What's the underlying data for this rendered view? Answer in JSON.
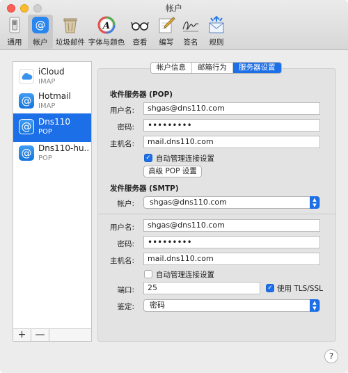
{
  "window": {
    "title": "帐户"
  },
  "toolbar": {
    "items": [
      {
        "label": "通用",
        "icon": "light-switch-icon"
      },
      {
        "label": "帐户",
        "icon": "at-sign-icon",
        "selected": true
      },
      {
        "label": "垃圾邮件",
        "icon": "trash-bin-icon"
      },
      {
        "label": "字体与颜色",
        "icon": "font-palette-icon"
      },
      {
        "label": "查看",
        "icon": "eyeglasses-icon"
      },
      {
        "label": "编写",
        "icon": "pencil-paper-icon"
      },
      {
        "label": "签名",
        "icon": "signature-icon"
      },
      {
        "label": "规则",
        "icon": "envelope-arrows-icon"
      }
    ]
  },
  "accounts": [
    {
      "name": "iCloud",
      "type": "IMAP",
      "icon": "cloud-icon"
    },
    {
      "name": "Hotmail",
      "type": "IMAP",
      "icon": "at-sign-icon"
    },
    {
      "name": "Dns110",
      "type": "POP",
      "icon": "at-sign-icon",
      "selected": true
    },
    {
      "name": "Dns110-hu...",
      "type": "POP",
      "icon": "at-sign-icon"
    }
  ],
  "list_buttons": {
    "add": "+",
    "remove": "—"
  },
  "tabs": [
    {
      "label": "帐户信息"
    },
    {
      "label": "邮箱行为"
    },
    {
      "label": "服务器设置",
      "selected": true
    }
  ],
  "incoming": {
    "heading": "收件服务器 (POP)",
    "username_label": "用户名:",
    "username": "shgas@dns110.com",
    "password_label": "密码:",
    "password": "•••••••••",
    "host_label": "主机名:",
    "host": "mail.dns110.com",
    "auto_manage_label": "自动管理连接设置",
    "auto_manage": true,
    "advanced_button": "高级 POP 设置"
  },
  "outgoing": {
    "heading": "发件服务器 (SMTP)",
    "account_label": "帐户:",
    "account": "shgas@dns110.com",
    "username_label": "用户名:",
    "username": "shgas@dns110.com",
    "password_label": "密码:",
    "password": "•••••••••",
    "host_label": "主机名:",
    "host": "mail.dns110.com",
    "auto_manage_label": "自动管理连接设置",
    "auto_manage": false,
    "port_label": "端口:",
    "port": "25",
    "tls_label": "使用 TLS/SSL",
    "tls": true,
    "auth_label": "鉴定:",
    "auth": "密码"
  },
  "help": {
    "label": "?"
  },
  "colors": {
    "accent": "#1d6fe8",
    "close": "#fd5f57",
    "minimize": "#fdbb2d"
  }
}
